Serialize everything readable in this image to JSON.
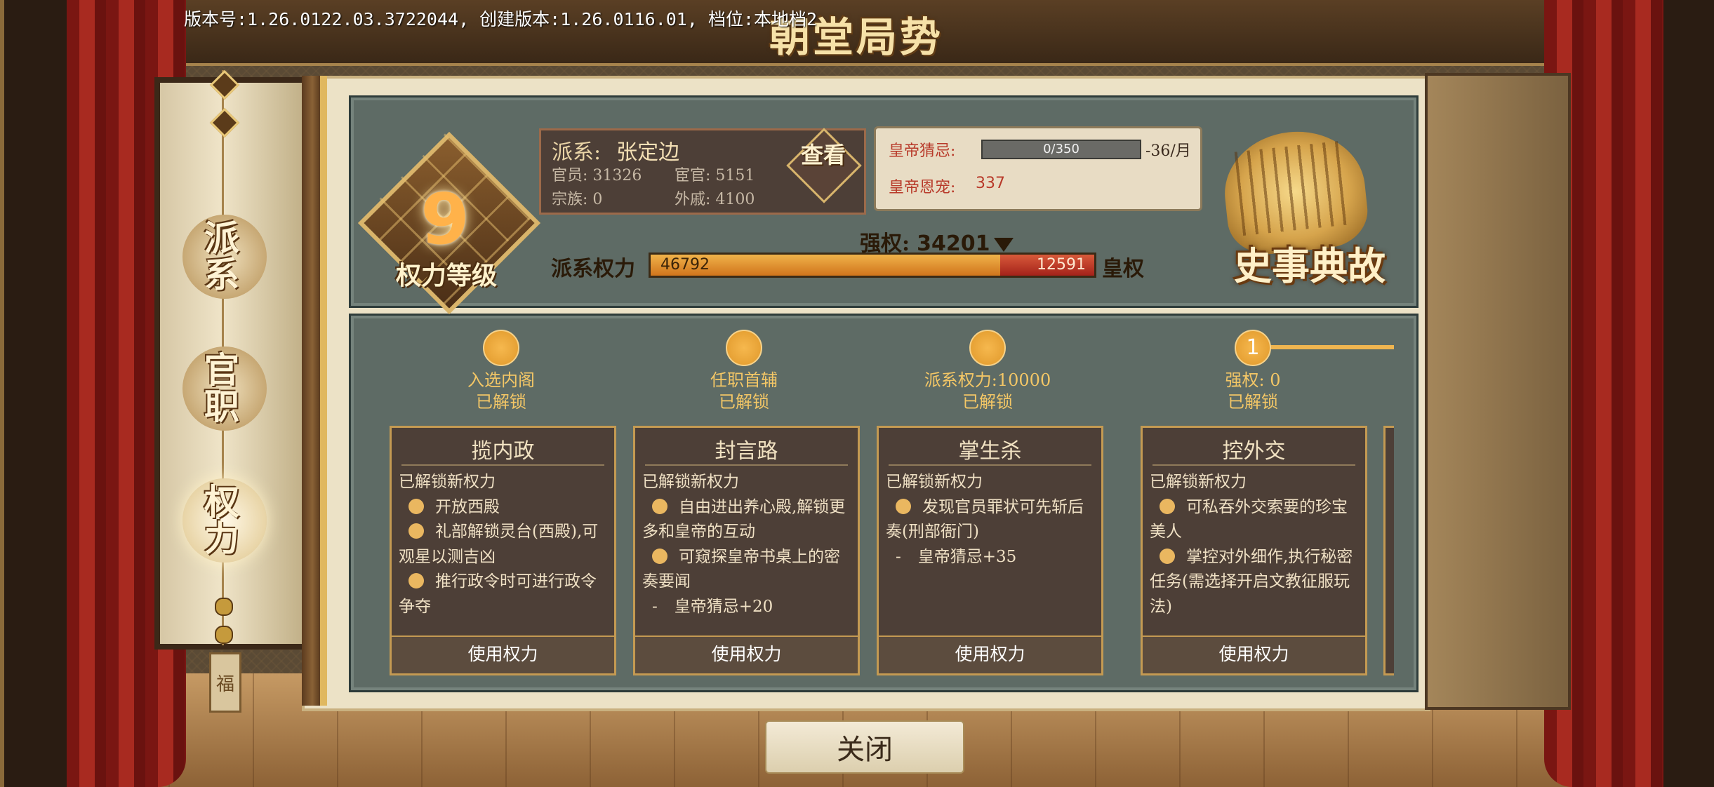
{
  "version_text": "版本号:1.26.0122.03.3722044, 创建版本:1.26.0116.01, 档位:本地档2",
  "title": "朝堂局势",
  "nav": {
    "items": [
      {
        "label": "派系"
      },
      {
        "label": "官职"
      },
      {
        "label": "权力"
      }
    ],
    "active": "权力",
    "tag": "福"
  },
  "level": {
    "value": "9",
    "label": "权力等级"
  },
  "faction": {
    "prefix": "派系:",
    "name": "张定边",
    "stats": {
      "official_label": "官员:",
      "official": "31326",
      "eunuch_label": "宦官:",
      "eunuch": "5151",
      "clan_label": "宗族:",
      "clan": "0",
      "inlaw_label": "外戚:",
      "inlaw": "4100"
    },
    "view_label": "查看"
  },
  "emperor": {
    "suspicion_label": "皇帝猜忌:",
    "suspicion_bar": "0/350",
    "suspicion_rate": "-36/月",
    "favor_label": "皇帝恩宠:",
    "favor_value": "337"
  },
  "power": {
    "strong_label": "强权:",
    "strong_value": "34201",
    "left_label": "派系权力",
    "right_label": "皇权",
    "faction_power": 46792,
    "imperial_power": 12591,
    "faction_power_text": "46792",
    "imperial_power_text": "12591"
  },
  "book_label": "史事典故",
  "milestones": [
    {
      "title": "入选内阁",
      "status": "已解锁",
      "number": ""
    },
    {
      "title": "任职首辅",
      "status": "已解锁",
      "number": ""
    },
    {
      "title": "派系权力:10000",
      "status": "已解锁",
      "number": ""
    },
    {
      "title": "强权: 0",
      "status": "已解锁",
      "number": "1"
    }
  ],
  "cards": [
    {
      "title": "揽内政",
      "subtitle": "已解锁新权力",
      "items": [
        "开放西殿",
        "礼部解锁灵台(西殿),可观星以测吉凶",
        "推行政令时可进行政令争夺"
      ],
      "effect": "",
      "button": "使用权力"
    },
    {
      "title": "封言路",
      "subtitle": "已解锁新权力",
      "items": [
        "自由进出养心殿,解锁更多和皇帝的互动",
        "可窥探皇帝书桌上的密奏要闻"
      ],
      "effect": "皇帝猜忌+20",
      "button": "使用权力"
    },
    {
      "title": "掌生杀",
      "subtitle": "已解锁新权力",
      "items": [
        "发现官员罪状可先斩后奏(刑部衙门)"
      ],
      "effect": "皇帝猜忌+35",
      "button": "使用权力"
    },
    {
      "title": "控外交",
      "subtitle": "已解锁新权力",
      "items": [
        "可私吞外交索要的珍宝美人",
        "掌控对外细作,执行秘密任务(需选择开启文教征服玩法)"
      ],
      "effect": "",
      "button": "使用权力"
    }
  ],
  "close_label": "关闭"
}
